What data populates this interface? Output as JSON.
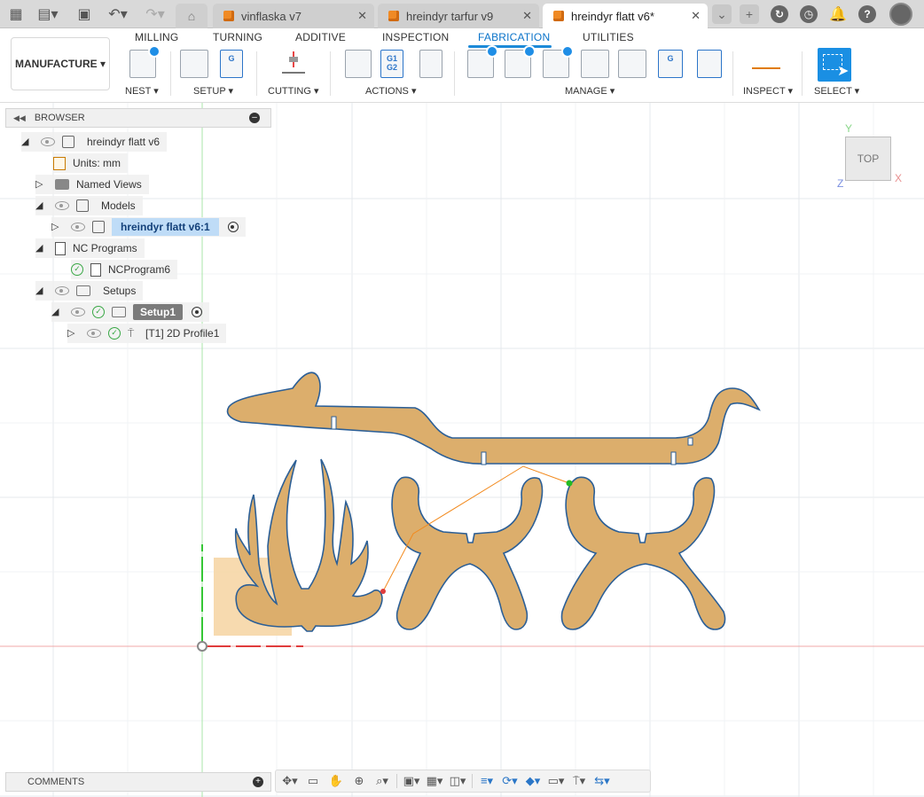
{
  "titlebar": {
    "tabs": [
      {
        "label": "vinflaska v7",
        "active": false
      },
      {
        "label": "hreindyr tarfur v9",
        "active": false
      },
      {
        "label": "hreindyr flatt v6*",
        "active": true
      }
    ],
    "close_glyph": "✕",
    "icons": [
      "app-grid-icon",
      "file-icon",
      "save-icon",
      "undo-icon",
      "redo-icon",
      "home-icon",
      "overflow-icon",
      "new-tab-icon",
      "extensions-icon",
      "job-status-icon",
      "notifications-icon",
      "help-icon",
      "avatar"
    ]
  },
  "ribbon": {
    "workspace": "MANUFACTURE",
    "tabs": [
      "MILLING",
      "TURNING",
      "ADDITIVE",
      "INSPECTION",
      "FABRICATION",
      "UTILITIES"
    ],
    "active_tab": "FABRICATION",
    "groups": [
      "NEST",
      "SETUP",
      "CUTTING",
      "ACTIONS",
      "MANAGE",
      "INSPECT",
      "SELECT"
    ],
    "accent": "#1c8ad8"
  },
  "browser": {
    "title": "BROWSER",
    "items": [
      {
        "label": "hreindyr flatt v6"
      },
      {
        "label": "Units: mm"
      },
      {
        "label": "Named Views"
      },
      {
        "label": "Models"
      },
      {
        "label": "hreindyr flatt v6:1",
        "selected": true
      },
      {
        "label": "NC Programs"
      },
      {
        "label": "NCProgram6"
      },
      {
        "label": "Setups"
      },
      {
        "label": "Setup1"
      },
      {
        "label": "[T1] 2D Profile1"
      }
    ]
  },
  "viewcube": {
    "face": "TOP",
    "axis_y": "Y",
    "axis_x": "X",
    "axis_z": "Z"
  },
  "comments": {
    "title": "COMMENTS"
  },
  "colors": {
    "wood": "#dcae6c",
    "outline": "#2c5f96",
    "toolpath": "#f28a1e",
    "stock": "#f6d3a1",
    "x_axis": "#e03c3c",
    "y_axis": "#36c736"
  }
}
